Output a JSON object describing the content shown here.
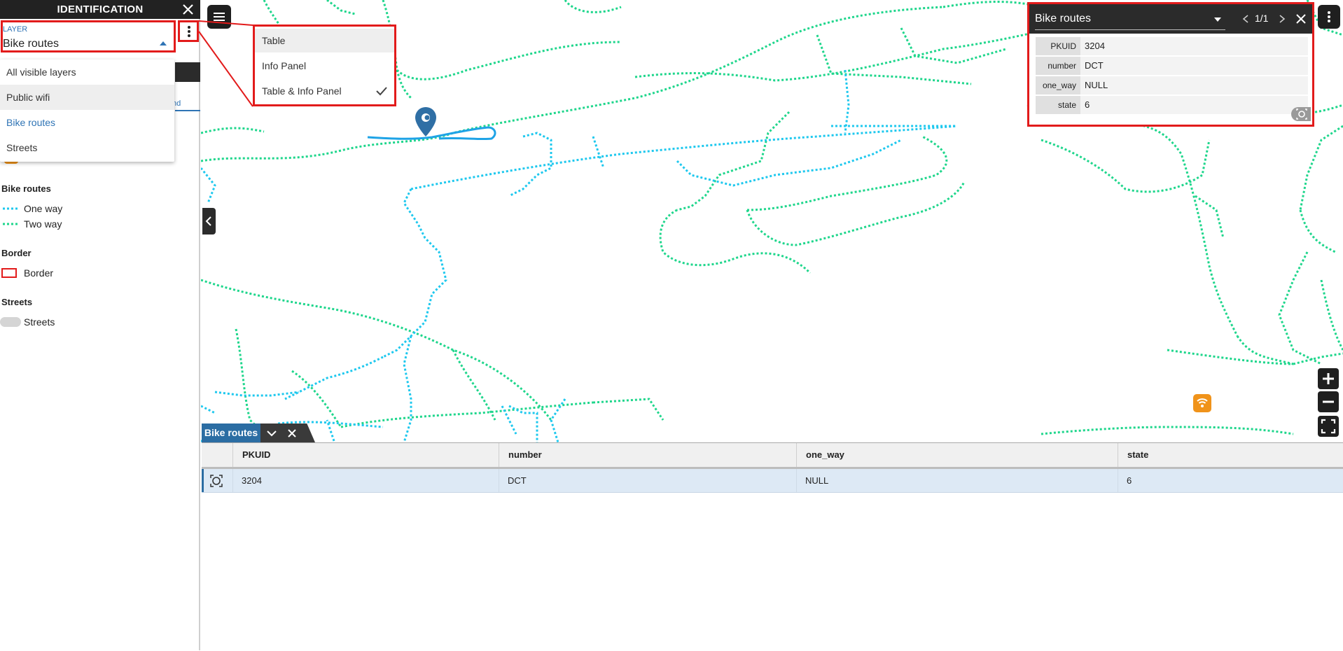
{
  "sidebar": {
    "title": "IDENTIFICATION",
    "layer_label": "LAYER",
    "layer_value": "Bike routes",
    "tab_fragment": "nd",
    "dropdown": {
      "items": [
        "All visible layers",
        "Public wifi",
        "Bike routes",
        "Streets"
      ],
      "hovered": "Public wifi",
      "selected": "Bike routes"
    },
    "legend": {
      "bike_routes_heading": "Bike routes",
      "one_way": "One way",
      "two_way": "Two way",
      "border_heading": "Border",
      "border_item": "Border",
      "streets_heading": "Streets",
      "streets_item": "Streets"
    }
  },
  "view_menu": {
    "items": [
      "Table",
      "Info Panel",
      "Table & Info Panel"
    ],
    "checked": "Table & Info Panel"
  },
  "info_panel": {
    "layer": "Bike routes",
    "counter": "1/1",
    "fields": [
      {
        "key": "PKUID",
        "value": "3204"
      },
      {
        "key": "number",
        "value": "DCT"
      },
      {
        "key": "one_way",
        "value": "NULL"
      },
      {
        "key": "state",
        "value": "6"
      }
    ]
  },
  "table": {
    "tab_label": "Bike routes",
    "columns": [
      "PKUID",
      "number",
      "one_way",
      "state"
    ],
    "rows": [
      [
        "3204",
        "DCT",
        "NULL",
        "6"
      ]
    ]
  },
  "colors": {
    "one_way": "#1ec8ee",
    "two_way": "#1fd68c",
    "highlight": "#e21b1b",
    "accent": "#2f74b5",
    "wifi": "#f0931a"
  },
  "icons": [
    "close-icon",
    "kebab-icon",
    "hamburger-icon",
    "chevron-left-icon",
    "check-icon",
    "zoom-to-icon",
    "plus-icon",
    "minus-icon",
    "fullscreen-icon",
    "wifi-icon",
    "map-pin-icon",
    "chevron-down-icon"
  ]
}
